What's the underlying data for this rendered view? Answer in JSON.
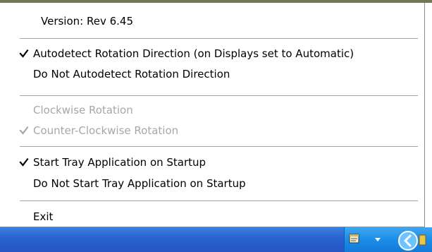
{
  "menu": {
    "version_label": "Version:  Rev 6.45",
    "items": [
      {
        "label": "Autodetect Rotation Direction (on Displays set to Automatic)",
        "checked": true,
        "enabled": true
      },
      {
        "label": "Do Not Autodetect Rotation Direction",
        "checked": false,
        "enabled": true
      },
      {
        "label": "Clockwise Rotation",
        "checked": false,
        "enabled": false
      },
      {
        "label": "Counter-Clockwise Rotation",
        "checked": true,
        "enabled": false
      },
      {
        "label": "Start Tray Application on Startup",
        "checked": true,
        "enabled": true
      },
      {
        "label": "Do Not Start Tray Application on Startup",
        "checked": false,
        "enabled": true
      },
      {
        "label": "Exit",
        "checked": false,
        "enabled": true
      }
    ]
  },
  "taskbar": {
    "tray_icons": [
      "notepad-icon",
      "chevron-down-icon",
      "circle-arrow-icon"
    ]
  },
  "colors": {
    "taskbar": "#2a63cf",
    "tray": "#1b8de8",
    "disabled_text": "#a7a7a7",
    "separator": "#a3a3a3"
  }
}
